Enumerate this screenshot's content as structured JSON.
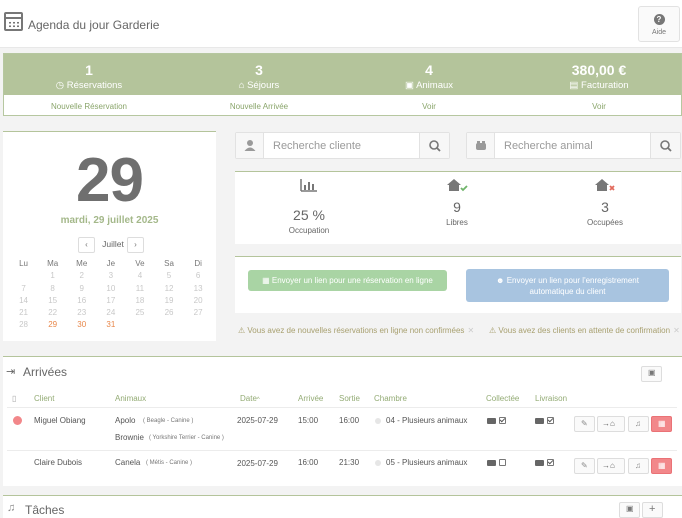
{
  "header": {
    "title": "Agenda du jour Garderie",
    "help_label": "Aide"
  },
  "stats": [
    {
      "value": "1",
      "label": "Réservations",
      "icon": "clock-icon",
      "link": "Nouvelle Réservation"
    },
    {
      "value": "3",
      "label": "Séjours",
      "icon": "home-icon",
      "link": "Nouvelle Arrivée"
    },
    {
      "value": "4",
      "label": "Animaux",
      "icon": "paw-icon",
      "link": "Voir"
    },
    {
      "value": "380,00 €",
      "label": "Facturation",
      "icon": "invoice-icon",
      "link": "Voir"
    }
  ],
  "date": {
    "day": "29",
    "full": "mardi, 29 juillet 2025",
    "month": "Juillet",
    "prev": "‹",
    "next": "›",
    "weekdays": [
      "Lu",
      "Ma",
      "Me",
      "Je",
      "Ve",
      "Sa",
      "Di"
    ],
    "weeks": [
      [
        "",
        "1",
        "2",
        "3",
        "4",
        "5",
        "6"
      ],
      [
        "7",
        "8",
        "9",
        "10",
        "11",
        "12",
        "13"
      ],
      [
        "14",
        "15",
        "16",
        "17",
        "18",
        "19",
        "20"
      ],
      [
        "21",
        "22",
        "23",
        "24",
        "25",
        "26",
        "27"
      ],
      [
        "28",
        "29",
        "30",
        "31",
        "",
        "",
        ""
      ]
    ]
  },
  "search": {
    "client_placeholder": "Recherche cliente",
    "animal_placeholder": "Recherche animal"
  },
  "occupancy": [
    {
      "value": "25 %",
      "label": "Occupation"
    },
    {
      "value": "9",
      "label": "Libres"
    },
    {
      "value": "3",
      "label": "Occupées"
    }
  ],
  "links": {
    "online_booking": "Envoyer un lien pour une réservation en ligne",
    "registration_1": "Envoyer un lien pour l'enregistrement",
    "registration_2": "automatique du client"
  },
  "warnings": [
    "Vous avez de nouvelles réservations en ligne non confirmées",
    "Vous avez des clients en attente de confirmation"
  ],
  "arrivals": {
    "title": "Arrivées",
    "columns": [
      "Client",
      "Animaux",
      "Date",
      "Arrivée",
      "Sortie",
      "Chambre",
      "Collectée",
      "Livraison"
    ],
    "date_sort": "^",
    "rows": [
      {
        "client": "Miguel Obiang",
        "pets": [
          {
            "name": "Apolo",
            "breed": "( Beagle - Canine )"
          },
          {
            "name": "Brownie",
            "breed": "( Yorkshire Terrier - Canine )"
          }
        ],
        "date": "2025-07-29",
        "arrival": "15:00",
        "exit": "16:00",
        "room": "04 - Plusieurs animaux",
        "collected": true,
        "delivery": true
      },
      {
        "client": "Claire Dubois",
        "pets": [
          {
            "name": "Canela",
            "breed": "( Métis - Canine )"
          }
        ],
        "date": "2025-07-29",
        "arrival": "16:00",
        "exit": "21:30",
        "room": "05 - Plusieurs animaux",
        "collected": false,
        "delivery": true
      }
    ]
  },
  "tasks": {
    "title": "Tâches",
    "add": "+"
  },
  "colors": {
    "accent": "#b4c49b",
    "link": "#8aa56b",
    "orange": "#e8874a",
    "red": "#f2878a",
    "green_btn": "#a9d4a4",
    "blue_btn": "#a8c4e0"
  }
}
